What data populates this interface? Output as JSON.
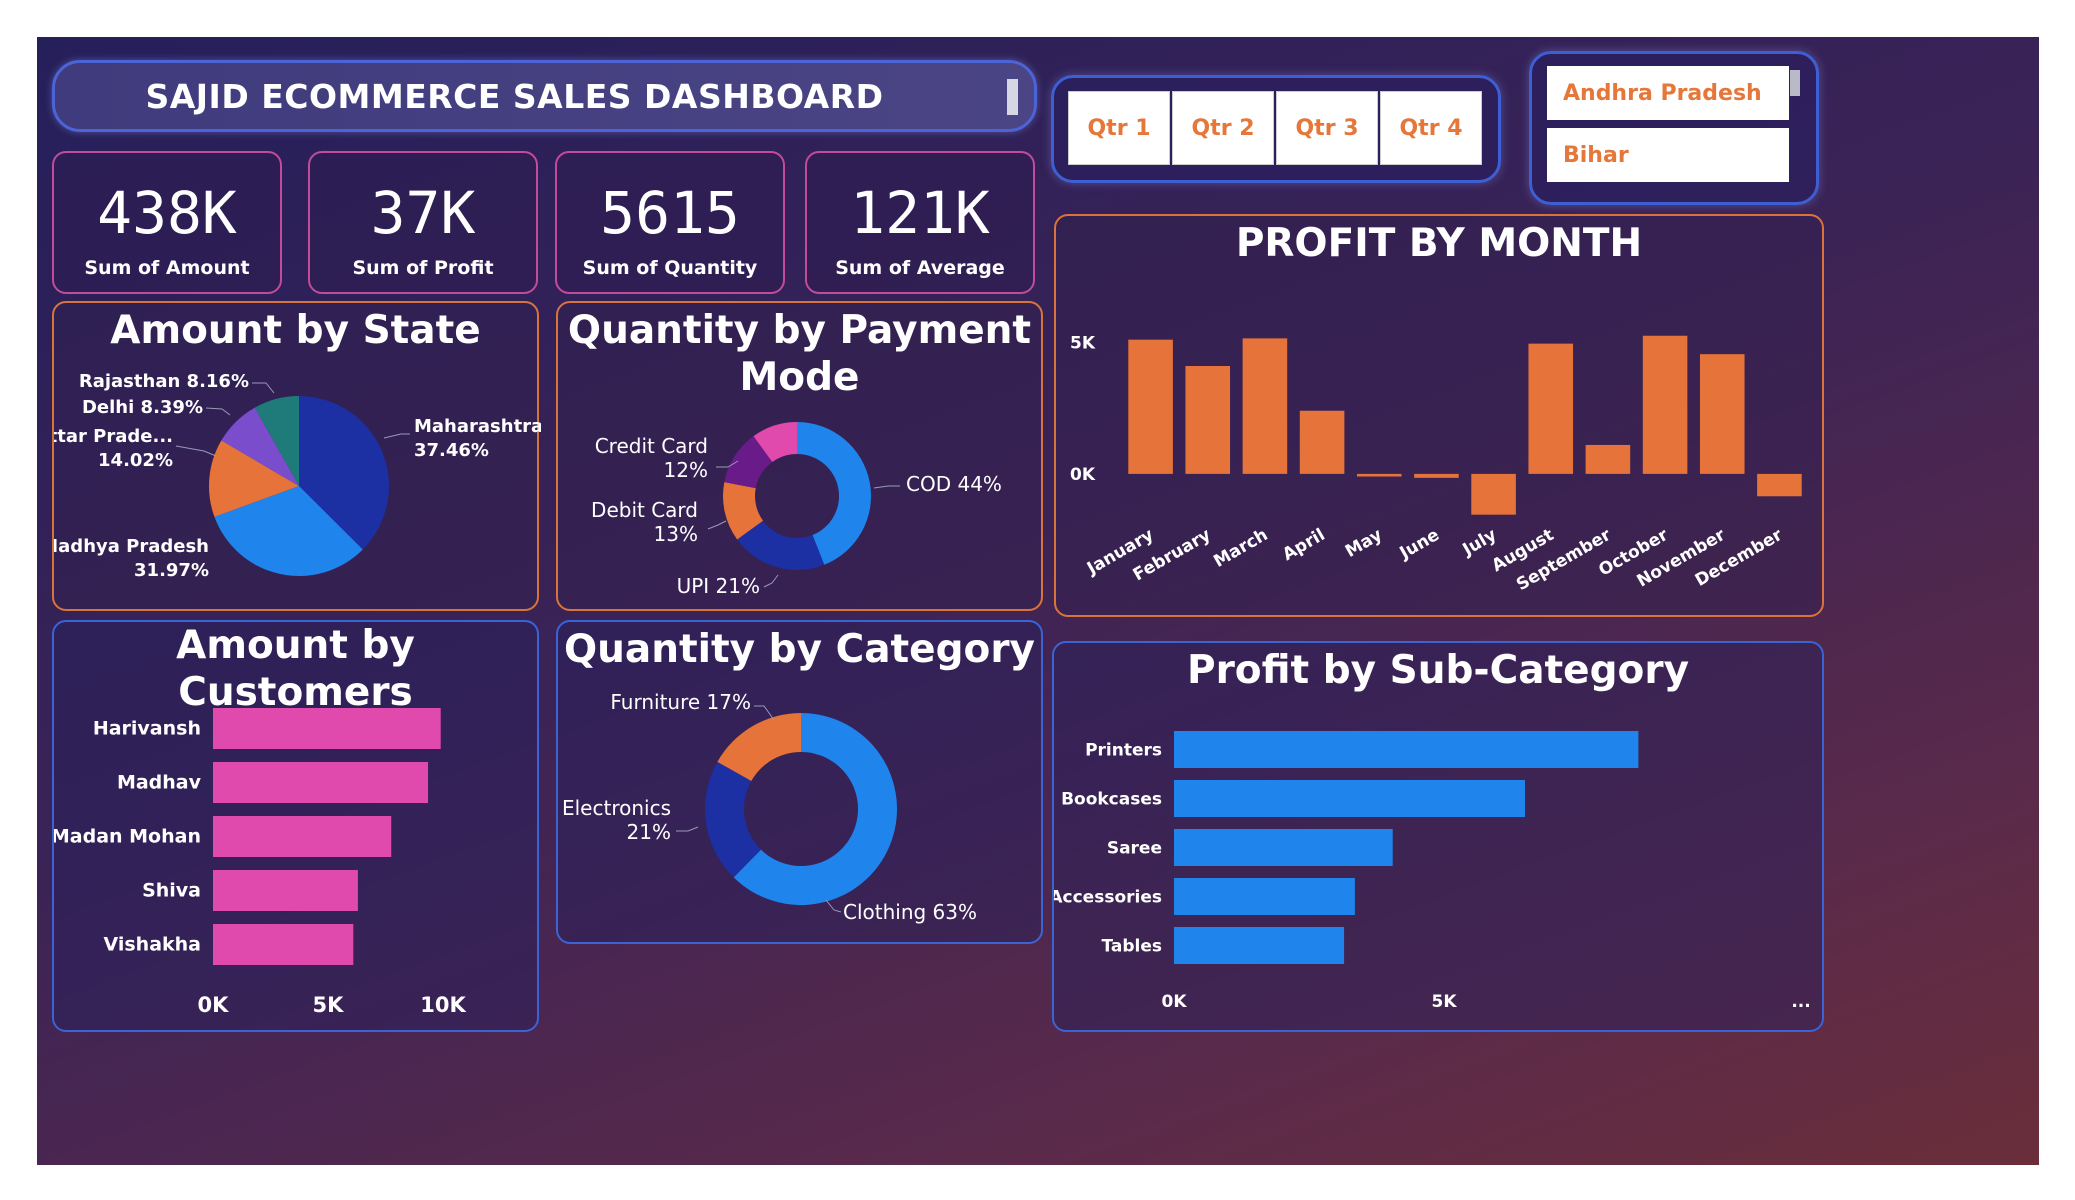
{
  "header": {
    "title": "SAJID ECOMMERCE SALES DASHBOARD"
  },
  "kpis": [
    {
      "value": "438K",
      "label": "Sum of Amount"
    },
    {
      "value": "37K",
      "label": "Sum of Profit"
    },
    {
      "value": "5615",
      "label": "Sum of Quantity"
    },
    {
      "value": "121K",
      "label": "Sum of Average"
    }
  ],
  "quarter_slicer": {
    "options": [
      "Qtr 1",
      "Qtr 2",
      "Qtr 3",
      "Qtr 4"
    ]
  },
  "state_slicer": {
    "options": [
      "Andhra Pradesh",
      "Bihar"
    ]
  },
  "colors": {
    "orange": "#e5733a",
    "pink": "#e04aac",
    "blue": "#1f84ec",
    "navy": "#1c2fa3"
  },
  "chart_data": [
    {
      "id": "amount_by_state",
      "type": "pie",
      "title": "Amount by State",
      "slices": [
        {
          "label": "Maharashtra",
          "pct_label": "37.46%",
          "value": 37.46,
          "color": "#1c2fa3"
        },
        {
          "label": "Madhya Pradesh",
          "pct_label": "31.97%",
          "value": 31.97,
          "color": "#1f84ec"
        },
        {
          "label": "Uttar Prade...",
          "pct_label": "14.02%",
          "value": 14.02,
          "color": "#e5733a"
        },
        {
          "label": "Delhi",
          "pct_label": "8.39%",
          "value": 8.39,
          "color": "#7a4dcc"
        },
        {
          "label": "Rajasthan",
          "pct_label": "8.16%",
          "value": 8.16,
          "color": "#1f7a7a"
        }
      ]
    },
    {
      "id": "quantity_by_payment_mode",
      "type": "pie",
      "donut": true,
      "title_lines": [
        "Quantity by Payment",
        "Mode"
      ],
      "slices": [
        {
          "label": "COD",
          "pct_label": "44%",
          "value": 44,
          "color": "#1f84ec"
        },
        {
          "label": "UPI",
          "pct_label": "21%",
          "value": 21,
          "color": "#1c2fa3"
        },
        {
          "label": "Debit Card",
          "pct_label": "13%",
          "value": 13,
          "color": "#e5733a"
        },
        {
          "label": "Credit Card",
          "pct_label": "12%",
          "value": 12,
          "color": "#6a1b8a"
        },
        {
          "label": "",
          "pct_label": "",
          "value": 10,
          "color": "#e04aac"
        }
      ]
    },
    {
      "id": "profit_by_month",
      "type": "bar",
      "title": "PROFIT BY MONTH",
      "categories": [
        "January",
        "February",
        "March",
        "April",
        "May",
        "June",
        "July",
        "August",
        "September",
        "October",
        "November",
        "December"
      ],
      "values": [
        5100,
        4100,
        5150,
        2400,
        -100,
        -150,
        -1550,
        4950,
        1100,
        5250,
        4550,
        -850
      ],
      "ylim": [
        -1600,
        6000
      ],
      "yticks": [
        {
          "v": 5000,
          "label": "5K"
        },
        {
          "v": 0,
          "label": "0K"
        }
      ],
      "color": "#e5733a"
    },
    {
      "id": "amount_by_customers",
      "type": "bar",
      "orientation": "horizontal",
      "title": "Amount by Customers",
      "categories": [
        "Harivansh",
        "Madhav",
        "Madan Mohan",
        "Shiva",
        "Vishakha"
      ],
      "values": [
        9900,
        9350,
        7750,
        6300,
        6100
      ],
      "xlim": [
        0,
        10000
      ],
      "xticks": [
        {
          "v": 0,
          "label": "0K"
        },
        {
          "v": 5000,
          "label": "5K"
        },
        {
          "v": 10000,
          "label": "10K"
        }
      ],
      "color": "#e04aac"
    },
    {
      "id": "quantity_by_category",
      "type": "pie",
      "donut": true,
      "title": "Quantity by Category",
      "slices": [
        {
          "label": "Clothing",
          "pct_label": "63%",
          "value": 63,
          "color": "#1f84ec"
        },
        {
          "label": "Electronics",
          "pct_label": "21%",
          "value": 21,
          "color": "#1c2fa3"
        },
        {
          "label": "Furniture",
          "pct_label": "17%",
          "value": 17,
          "color": "#e5733a"
        }
      ]
    },
    {
      "id": "profit_by_sub_category",
      "type": "bar",
      "orientation": "horizontal",
      "title": "Profit by Sub-Category",
      "categories": [
        "Printers",
        "Bookcases",
        "Saree",
        "Accessories",
        "Tables"
      ],
      "values": [
        8600,
        6500,
        4050,
        3350,
        3150
      ],
      "xlim": [
        0,
        10000
      ],
      "xticks": [
        {
          "v": 0,
          "label": "0K"
        },
        {
          "v": 5000,
          "label": "5K"
        }
      ],
      "more_label": "...",
      "color": "#1f84ec"
    }
  ]
}
